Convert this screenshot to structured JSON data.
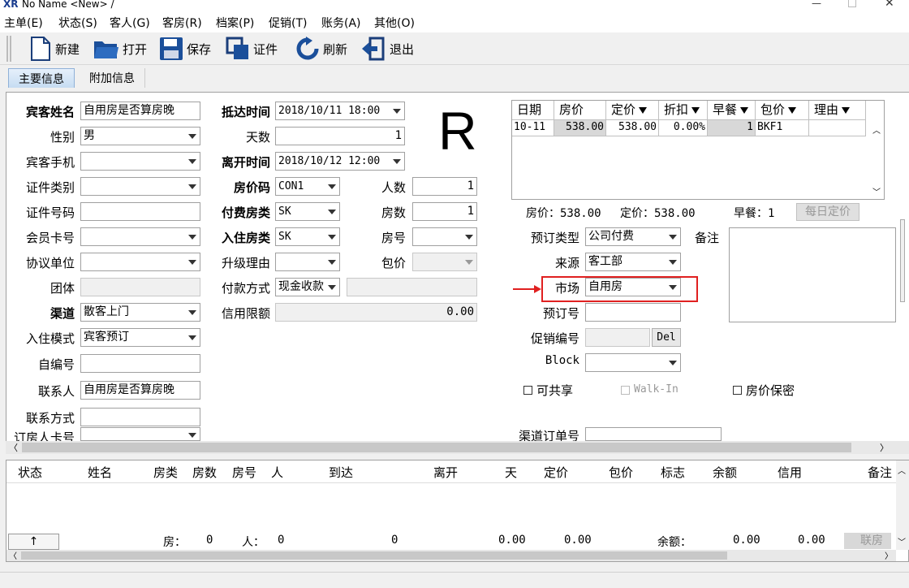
{
  "window": {
    "title": "No Name <New> /",
    "logo": "XR"
  },
  "menu": [
    "主单(E)",
    "状态(S)",
    "客人(G)",
    "客房(R)",
    "档案(P)",
    "促销(T)",
    "账务(A)",
    "其他(O)"
  ],
  "toolbar": {
    "new": "新建",
    "open": "打开",
    "save": "保存",
    "cert": "证件",
    "refresh": "刷新",
    "exit": "退出"
  },
  "tabs": {
    "main": "主要信息",
    "extra": "附加信息"
  },
  "form": {
    "guest_name_label": "宾客姓名",
    "guest_name": "自用房是否算房晚",
    "gender_label": "性别",
    "gender": "男",
    "mobile_label": "宾客手机",
    "mobile": "",
    "id_type_label": "证件类别",
    "id_type": "",
    "id_no_label": "证件号码",
    "id_no": "",
    "member_label": "会员卡号",
    "member": "",
    "agreement_label": "协议单位",
    "agreement": "",
    "group_label": "团体",
    "group": "",
    "channel_label": "渠道",
    "channel": "散客上门",
    "checkin_mode_label": "入住模式",
    "checkin_mode": "宾客预订",
    "self_no_label": "自编号",
    "self_no": "",
    "contact_label": "联系人",
    "contact": "自用房是否算房晚",
    "contact_method_label": "联系方式",
    "contact_method": "",
    "booker_card_label": "订房人卡号",
    "booker_card": "",
    "arrival_label": "抵达时间",
    "arrival": "2018/10/11 18:00",
    "days_label": "天数",
    "days": "1",
    "departure_label": "离开时间",
    "departure": "2018/10/12 12:00",
    "rate_code_label": "房价码",
    "rate_code": "CON1",
    "persons_label": "人数",
    "persons": "1",
    "pay_room_type_label": "付费房类",
    "pay_room_type": "SK",
    "rooms_label": "房数",
    "rooms": "1",
    "room_type_label": "入住房类",
    "room_type": "SK",
    "room_no_label": "房号",
    "room_no": "",
    "upgrade_label": "升级理由",
    "upgrade": "",
    "package_label": "包价",
    "package": "",
    "pay_method_label": "付款方式",
    "pay_method": "现金收款",
    "pay_method_extra": "",
    "credit_label": "信用限额",
    "credit": "0.00",
    "big_letter": "R",
    "booking_type_label": "预订类型",
    "booking_type": "公司付费",
    "source_label": "来源",
    "source": "客工部",
    "market_label": "市场",
    "market": "自用房",
    "booking_no_label": "预订号",
    "booking_no": "",
    "promo_label": "促销编号",
    "promo": "",
    "del_label": "Del",
    "block_label": "Block",
    "block": "",
    "remark_label": "备注",
    "remark": "",
    "shareable_label": "可共享",
    "walkin_label": "Walk-In",
    "rate_secret_label": "房价保密",
    "channel_order_label": "渠道订单号",
    "channel_order": "",
    "highlight_color": "#e02020"
  },
  "rate_grid": {
    "headers": [
      "日期",
      "房价",
      "定价",
      "折扣",
      "早餐",
      "包价",
      "理由"
    ],
    "rows": [
      [
        "10-11",
        "538.00",
        "538.00",
        "0.00%",
        "1",
        "BKF1",
        ""
      ]
    ],
    "summary_room_label": "房价：538.00",
    "summary_fixed_label": "定价：538.00",
    "summary_breakfast_label": "早餐：1",
    "daily_button": "每日定价"
  },
  "bottom": {
    "headers": [
      "状态",
      "姓名",
      "房类",
      "房数",
      "房号",
      "人",
      "到达",
      "离开",
      "天",
      "定价",
      "包价",
      "标志",
      "余额",
      "信用",
      "备注"
    ],
    "summary": {
      "arrow": "↑",
      "rooms_label": "房：",
      "rooms": "0",
      "persons_label": "人：",
      "persons": "0",
      "v1": "0",
      "v2": "0.00",
      "v3": "0.00",
      "balance_label": "余额：",
      "balance": "0.00",
      "credit": "0.00",
      "link_button": "联房"
    }
  }
}
